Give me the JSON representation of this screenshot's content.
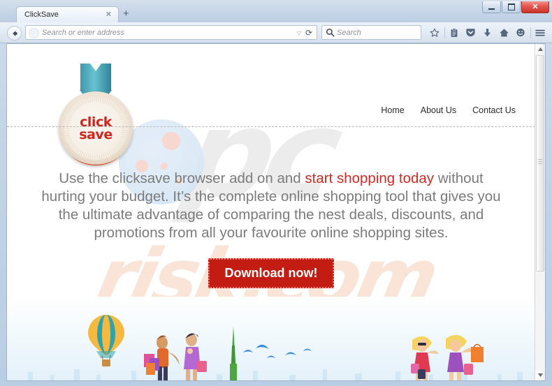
{
  "window": {
    "controls": {
      "minimize": "minimize-button",
      "maximize": "maximize-button",
      "close_label": "✕"
    }
  },
  "browser": {
    "tab": {
      "title": "ClickSave",
      "close_label": "✕"
    },
    "new_tab_label": "+",
    "back_button": "back-arrow-icon",
    "address_bar": {
      "value": "",
      "placeholder": "Search or enter address",
      "dropdown_label": "▽",
      "reload_label": "⟳"
    },
    "search_bar": {
      "value": "",
      "placeholder": "Search"
    },
    "toolbar_icons": [
      {
        "name": "bookmark-star-icon",
        "glyph": "☆"
      },
      {
        "name": "reader-mode-icon",
        "glyph": "Ὄb"
      },
      {
        "name": "pocket-shield-icon",
        "glyph": "▽"
      },
      {
        "name": "downloads-icon",
        "glyph": "⬇"
      },
      {
        "name": "home-icon",
        "glyph": "⌂"
      },
      {
        "name": "feedback-smiley-icon",
        "glyph": "☺"
      },
      {
        "name": "hamburger-menu-icon",
        "glyph": "☰"
      }
    ]
  },
  "page": {
    "watermark_top": "pc",
    "watermark_bottom": "risk.com",
    "logo": {
      "line1": "click",
      "line2": "save",
      "arrow": "down-arrow-icon"
    },
    "nav": [
      {
        "label": "Home"
      },
      {
        "label": "About Us"
      },
      {
        "label": "Contact Us"
      }
    ],
    "hero": {
      "part1": "Use the clicksave browser add on and ",
      "highlight": "start shopping today",
      "part2": " without hurting your budget. It’s the complete online shopping tool that gives you the ultimate advantage of comparing the nest deals, discounts, and promotions from all your favourite online shopping sites."
    },
    "download_button": "Download now!",
    "footer_art": {
      "items": [
        "hot-air-balloon",
        "shopper-woman-pink-bags",
        "shopper-woman-purple",
        "green-tower",
        "blue-birds",
        "shopper-blonde-red-dress",
        "shopper-blonde-purple-dress",
        "city-skyline"
      ]
    }
  },
  "scrollbar": {
    "up_label": "▲",
    "down_label": "▼"
  },
  "colors": {
    "accent_red": "#c31c12",
    "logo_red": "#cf2720",
    "highlight_red": "#cf2a24",
    "teal": "#3aa8b8",
    "watermark_gray": "#ececec",
    "watermark_peach": "#fae4d8"
  }
}
